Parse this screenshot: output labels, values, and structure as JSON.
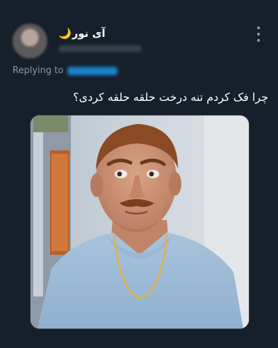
{
  "user": {
    "display_name": "آی نور",
    "emoji": "🌙",
    "avatar": "blurred-profile-photo"
  },
  "menu": {
    "icon": "more-vertical-icon"
  },
  "reply": {
    "label": "Replying to"
  },
  "tweet": {
    "text": "چرا فک کردم تنه درخت حلقه حلقه کردی؟"
  },
  "media": {
    "type": "photo",
    "subject": "man-in-light-blue-shirt-with-gold-chain"
  },
  "colors": {
    "background": "#15202b",
    "text_primary": "#ffffff",
    "text_secondary": "#8b98a5",
    "link": "#1d9bf0"
  }
}
